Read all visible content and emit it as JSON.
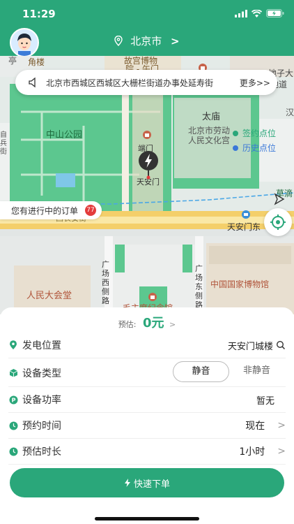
{
  "status": {
    "time": "11:29"
  },
  "header": {
    "city": "北京市",
    "city_chevron": ">"
  },
  "map": {
    "labels": {
      "poi_top_1": "亭",
      "poi_top_2": "故宫博物",
      "poi_top_3": "院 - 午门",
      "poi_top_4": "地子大",
      "poi_top_5": "地道",
      "jiao_lou": "角楼",
      "zhongshan_park": "中山公园",
      "tai_miao": "太庙",
      "laodong_1": "北京市劳动",
      "laodong_2": "人民文化宫",
      "han": "汉",
      "duan_men": "端门",
      "tiananmen": "天安门",
      "sign_point": "签约点位",
      "history_point": "历史点位",
      "xi_changan": "西长安街",
      "tiananmen_east": "天安门东",
      "gc_west_1": "广",
      "gc_west_2": "场",
      "gc_west_3": "西",
      "gc_west_4": "侧",
      "gc_west_5": "路",
      "gc_east_1": "广",
      "gc_east_2": "场",
      "gc_east_3": "东",
      "gc_east_4": "侧",
      "gc_east_5": "路",
      "great_hall": "人民大会堂",
      "museum": "中国国家博物馆",
      "memorial": "毛主席纪念馆",
      "cao": "草滴",
      "side_1": "自",
      "side_2": "兵",
      "side_3": "街"
    }
  },
  "notice": {
    "text": "北京市西城区西城区大栅栏街道办事处延寿街",
    "more": "更多>>"
  },
  "pending": {
    "label": "您有进行中的订单",
    "count": "77"
  },
  "panel": {
    "estimate_label": "预估:",
    "price": "0元",
    "estimate_chevron": ">",
    "rows": [
      {
        "label": "发电位置",
        "value": "天安门城楼"
      },
      {
        "label": "设备类型",
        "options": [
          "静音",
          "非静音"
        ]
      },
      {
        "label": "设备功率",
        "value": "暂无"
      },
      {
        "label": "预约时间",
        "value": "现在"
      },
      {
        "label": "预估时长",
        "value": "1小时"
      }
    ],
    "chevron": ">"
  },
  "order_button": {
    "label": "快速下单"
  },
  "colors": {
    "brand": "#2aa77a",
    "map_green": "#5cc78f",
    "badge": "#e43c3c"
  }
}
